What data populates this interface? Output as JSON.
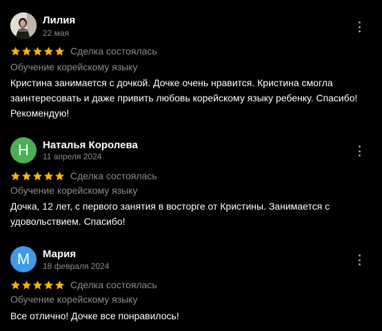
{
  "colors": {
    "background": "#000000",
    "star": "#f7b500",
    "muted_text": "#8c8c8c",
    "avatar_green": "#4caf50",
    "avatar_blue": "#3d9be9"
  },
  "reviews": [
    {
      "name": "Лилия",
      "date": "22 мая",
      "avatar_type": "photo",
      "rating": 5,
      "deal_status": "Сделка состоялась",
      "subject": "Обучение корейскому языку",
      "text": "Кристина занимается с дочкой. Дочке очень нравится. Кристина смогла заинтересовать  и  даже привить любовь корейскому языку ребенку. Спасибо! Рекомендую!"
    },
    {
      "name": "Наталья Королева",
      "date": "11 апреля 2024",
      "avatar_letter": "Н",
      "rating": 5,
      "deal_status": "Сделка состоялась",
      "subject": "Обучение корейскому языку",
      "text": "Дочка, 12 лет, с первого занятия в восторге от Кристины. Занимается с удовольствием. Спасибо!"
    },
    {
      "name": "Мария",
      "date": "18 февраля 2024",
      "avatar_letter": "М",
      "rating": 5,
      "deal_status": "Сделка состоялась",
      "subject": "Обучение корейскому языку",
      "text": "Все отлично! Дочке все понравилось!"
    }
  ]
}
